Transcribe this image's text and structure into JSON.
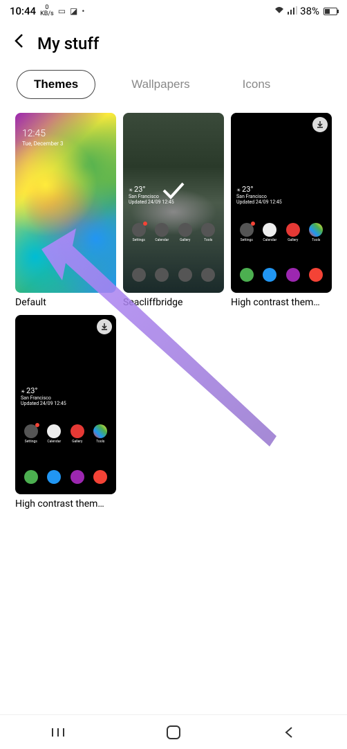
{
  "statusBar": {
    "time": "10:44",
    "speed": "0",
    "speedUnit": "KB/s",
    "batteryPercent": "38%"
  },
  "header": {
    "title": "My stuff"
  },
  "tabs": [
    {
      "label": "Themes",
      "active": true
    },
    {
      "label": "Wallpapers",
      "active": false
    },
    {
      "label": "Icons",
      "active": false
    }
  ],
  "themes": [
    {
      "label": "Default",
      "previewTime": "12:45",
      "previewDate": "Tue, December 3",
      "type": "default",
      "selected": false,
      "downloadable": false
    },
    {
      "label": "Seacliffbridge",
      "type": "seacliff",
      "temp": "23°",
      "location": "San Francisco",
      "updated": "Updated 24/09 12:45",
      "selected": true,
      "downloadable": false
    },
    {
      "label": "High contrast them…",
      "type": "dark",
      "temp": "23°",
      "location": "San Francisco",
      "updated": "Updated 24/09 12:45",
      "selected": false,
      "downloadable": true
    },
    {
      "label": "High contrast them…",
      "type": "dark",
      "temp": "23°",
      "location": "San Francisco",
      "updated": "Updated 24/09 12:45",
      "selected": false,
      "downloadable": true
    }
  ],
  "appIcons": {
    "row1": [
      "Settings",
      "Calendar",
      "Gallery",
      "Tools"
    ],
    "row2": [
      "",
      "",
      "",
      ""
    ]
  }
}
